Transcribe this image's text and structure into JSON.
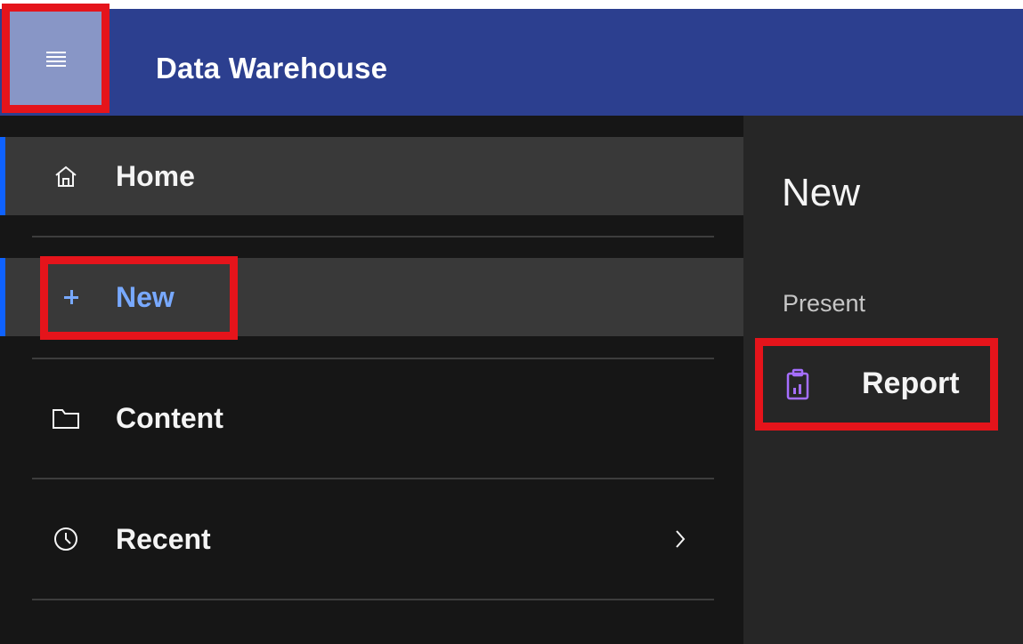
{
  "header": {
    "title": "Data Warehouse",
    "menu_icon": "hamburger-menu-icon",
    "background": "#2c3f8f"
  },
  "nav": {
    "items": [
      {
        "label": "Home",
        "icon": "home-icon",
        "active": true
      },
      {
        "label": "New",
        "icon": "plus-icon",
        "active": true,
        "color": "#78a9ff"
      },
      {
        "label": "Content",
        "icon": "folder-icon",
        "active": false
      },
      {
        "label": "Recent",
        "icon": "clock-icon",
        "active": false,
        "has_submenu": true
      }
    ]
  },
  "flyout": {
    "title": "New",
    "section": "Present",
    "items": [
      {
        "label": "Report",
        "icon": "report-icon",
        "icon_color": "#a56eff"
      }
    ]
  },
  "colors": {
    "accent": "#0f62fe",
    "highlight": "#e5141b"
  }
}
